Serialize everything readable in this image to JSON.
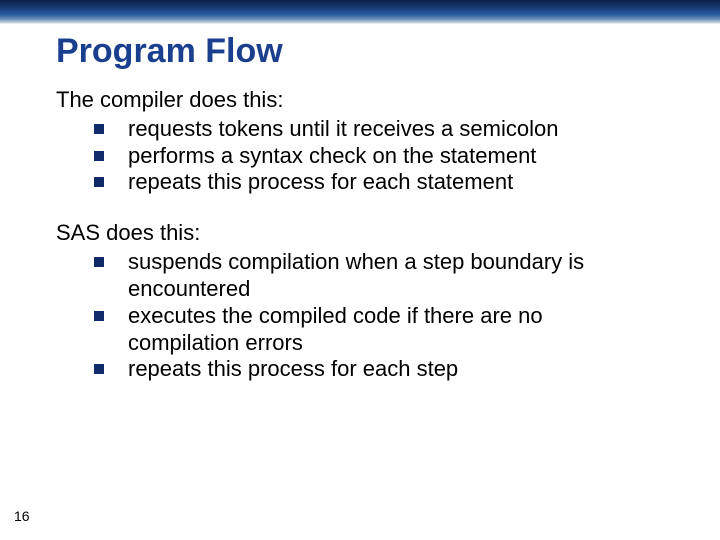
{
  "title": "Program Flow",
  "section1": {
    "lead": "The compiler does this:",
    "items": [
      "requests tokens until it receives a semicolon",
      "performs a syntax check on the statement",
      "repeats this process for each statement"
    ]
  },
  "section2": {
    "lead": "SAS does this:",
    "items": [
      "suspends compilation when a step boundary is encountered",
      "executes the compiled code if there are no compilation errors",
      "repeats this process for each step"
    ]
  },
  "page_number": "16"
}
